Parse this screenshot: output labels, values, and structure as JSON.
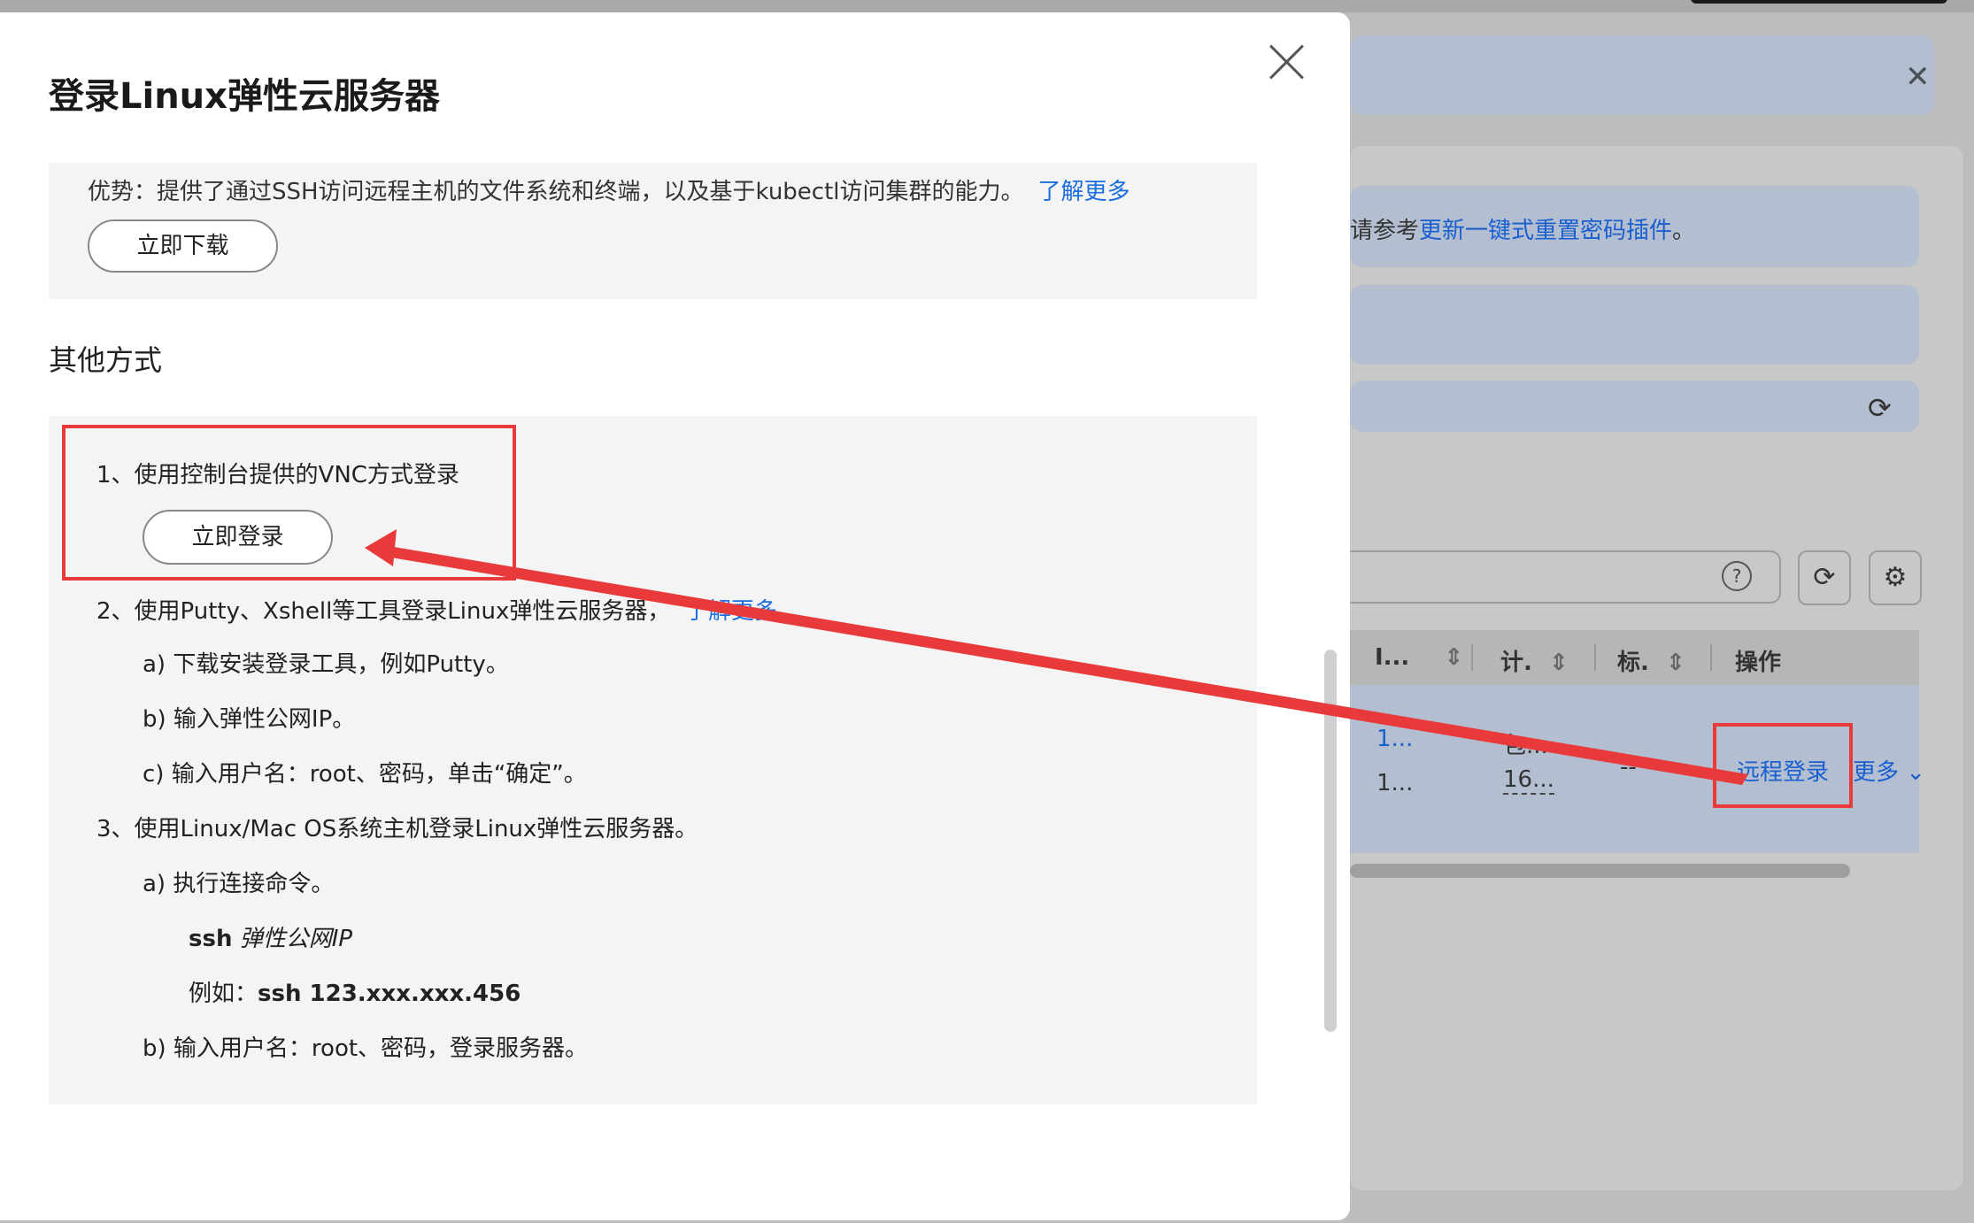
{
  "modal": {
    "title": "登录Linux弹性云服务器",
    "advantage_text": "优势：提供了通过SSH访问远程主机的文件系统和终端，以及基于kubectl访问集群的能力。",
    "advantage_link": "了解更多",
    "download_button": "立即下载",
    "section_title": "其他方式",
    "step1": "1、使用控制台提供的VNC方式登录",
    "login_button": "立即登录",
    "step2": "2、使用Putty、Xshell等工具登录Linux弹性云服务器，",
    "step2_link": "了解更多",
    "step2_a": "a) 下载安装登录工具，例如Putty。",
    "step2_b": "b) 输入弹性公网IP。",
    "step2_c": "c) 输入用户名：root、密码，单击“确定”。",
    "step3": "3、使用Linux/Mac OS系统主机登录Linux弹性云服务器。",
    "step3_a": "a) 执行连接命令。",
    "cmd_bold": "ssh",
    "cmd_italic": "弹性公网IP",
    "example_label": "例如：",
    "example_cmd": "ssh 123.xxx.xxx.456",
    "step3_b": "b) 输入用户名：root、密码，登录服务器。"
  },
  "background": {
    "note_prefix": "请参考",
    "note_link": "更新一键式重置密码插件",
    "note_suffix": "。",
    "table": {
      "headers": [
        "I...",
        "计.",
        "标.",
        "操作"
      ],
      "row": {
        "ip_line1": "1...",
        "ip_line2": "1...",
        "billing_line1": "包...",
        "billing_line2": "16...",
        "tag": "--",
        "action_remote": "远程登录",
        "action_more": "更多"
      }
    }
  },
  "colors": {
    "link": "#1a6ee0",
    "highlight": "#e83a3a"
  }
}
